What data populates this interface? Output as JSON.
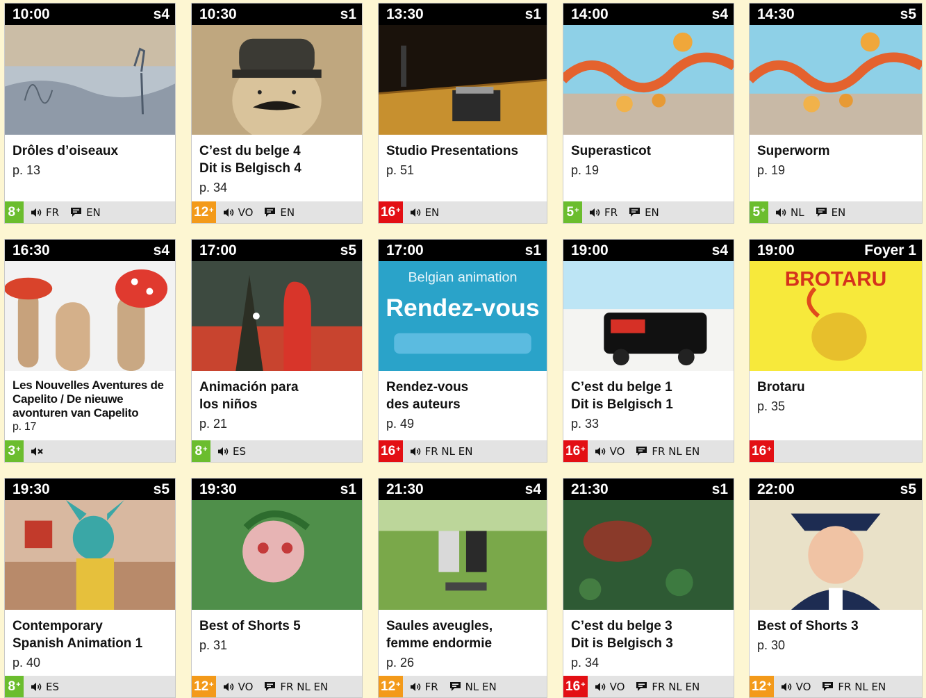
{
  "colors": {
    "age_8": "#6bbd2e",
    "age_5": "#6bbd2e",
    "age_3": "#6bbd2e",
    "age_12": "#f39a1a",
    "age_16": "#e30f14",
    "header": "#000000",
    "footer": "#e3e3e3",
    "page_background": "#fdf6d2"
  },
  "icons": {
    "audio": "speaker-icon",
    "subtitles": "speech-bubble-icon",
    "silent": "muted-speaker-icon"
  },
  "screenings": [
    {
      "time": "10:00",
      "room": "s4",
      "title": "Drôles d’oiseaux",
      "page": "p. 13",
      "age": "8",
      "audio": "FR",
      "subtitles": "EN"
    },
    {
      "time": "10:30",
      "room": "s1",
      "title": "C’est du belge 4\nDit is Belgisch 4",
      "page": "p. 34",
      "age": "12",
      "audio": "VO",
      "subtitles": "EN"
    },
    {
      "time": "13:30",
      "room": "s1",
      "title": "Studio Presentations",
      "page": "p. 51",
      "age": "16",
      "audio": "EN",
      "subtitles": ""
    },
    {
      "time": "14:00",
      "room": "s4",
      "title": "Superasticot",
      "page": "p. 19",
      "age": "5",
      "audio": "FR",
      "subtitles": "EN"
    },
    {
      "time": "14:30",
      "room": "s5",
      "title": "Superworm",
      "page": "p. 19",
      "age": "5",
      "audio": "NL",
      "subtitles": "EN"
    },
    {
      "time": "16:30",
      "room": "s4",
      "title": "Les Nouvelles Aventures de Capelito / De nieuwe avonturen van Capelito",
      "page": "p. 17",
      "age": "3",
      "audio": "",
      "subtitles": "",
      "silent": true
    },
    {
      "time": "17:00",
      "room": "s5",
      "title": "Animación para\nlos niños",
      "page": "p. 21",
      "age": "8",
      "audio": "ES",
      "subtitles": ""
    },
    {
      "time": "17:00",
      "room": "s1",
      "title": "Rendez-vous\ndes auteurs",
      "page": "p. 49",
      "age": "16",
      "audio": "FR NL EN",
      "subtitles": ""
    },
    {
      "time": "19:00",
      "room": "s4",
      "title": "C’est du belge 1\nDit is Belgisch 1",
      "page": "p. 33",
      "age": "16",
      "audio": "VO",
      "subtitles": "FR NL EN"
    },
    {
      "time": "19:00",
      "room": "Foyer 1",
      "title": "Brotaru",
      "page": "p. 35",
      "age": "16",
      "audio": "",
      "subtitles": "",
      "image_text": "BROTARU"
    },
    {
      "time": "19:30",
      "room": "s5",
      "title": "Contemporary\nSpanish Animation 1",
      "page": "p. 40",
      "age": "8",
      "audio": "ES",
      "subtitles": ""
    },
    {
      "time": "19:30",
      "room": "s1",
      "title": "Best of Shorts 5",
      "page": "p. 31",
      "age": "12",
      "audio": "VO",
      "subtitles": "FR NL EN"
    },
    {
      "time": "21:30",
      "room": "s4",
      "title": "Saules aveugles,\nfemme endormie",
      "page": "p. 26",
      "age": "12",
      "audio": "FR",
      "subtitles": "NL EN"
    },
    {
      "time": "21:30",
      "room": "s1",
      "title": "C’est du belge 3\nDit is Belgisch 3",
      "page": "p. 34",
      "age": "16",
      "audio": "VO",
      "subtitles": "FR NL EN"
    },
    {
      "time": "22:00",
      "room": "s5",
      "title": "Best of Shorts 3",
      "page": "p. 30",
      "age": "12",
      "audio": "VO",
      "subtitles": "FR NL EN"
    }
  ],
  "images": {
    "rendezvous_lines": [
      "Belgian animation",
      "Rendez-vous"
    ]
  }
}
